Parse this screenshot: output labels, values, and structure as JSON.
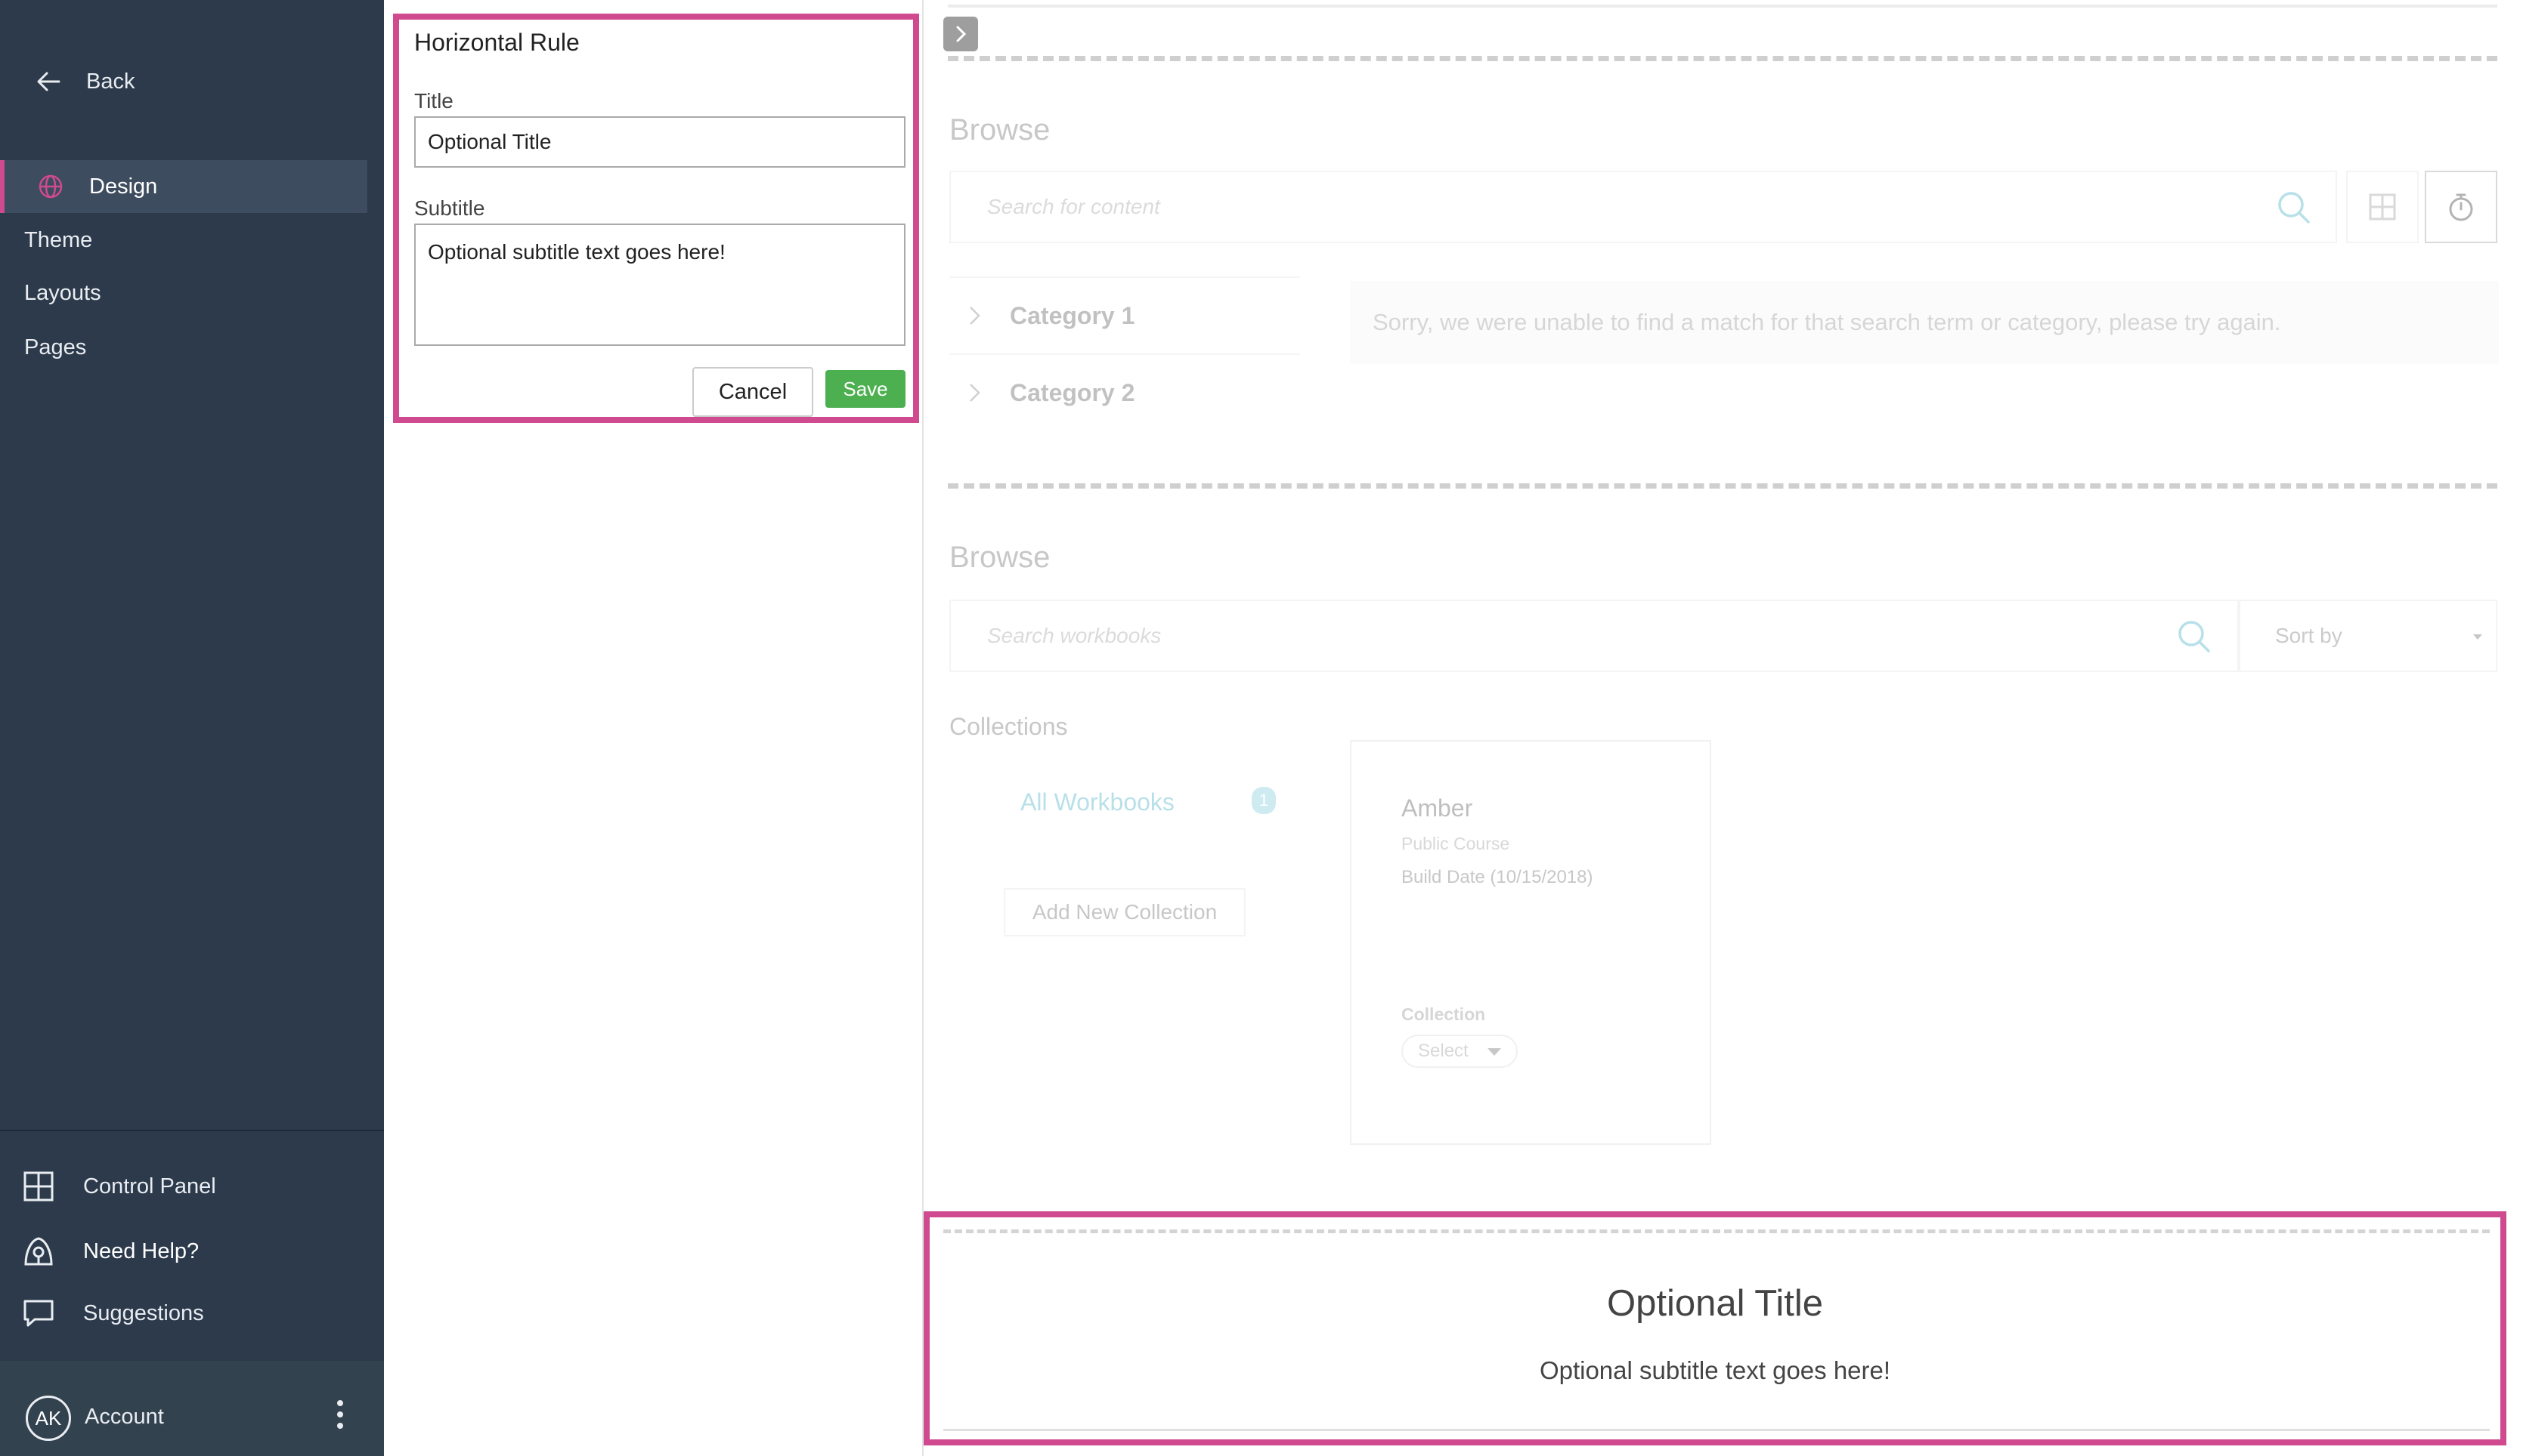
{
  "sidebar": {
    "back_label": "Back",
    "design_label": "Design",
    "items": [
      {
        "label": "Theme"
      },
      {
        "label": "Layouts"
      },
      {
        "label": "Pages"
      }
    ],
    "bottom": {
      "control_panel": "Control Panel",
      "need_help": "Need Help?",
      "suggestions": "Suggestions"
    },
    "account": {
      "initials": "AK",
      "label": "Account"
    }
  },
  "editor": {
    "heading": "Horizontal Rule",
    "title_label": "Title",
    "title_value": "Optional Title",
    "subtitle_label": "Subtitle",
    "subtitle_value": "Optional subtitle text goes here!",
    "cancel_label": "Cancel",
    "save_label": "Save"
  },
  "canvas": {
    "browse1": {
      "title": "Browse",
      "search_placeholder": "Search for content",
      "categories": [
        {
          "label": "Category 1"
        },
        {
          "label": "Category 2"
        }
      ],
      "no_match_text": "Sorry, we were unable to find a match for that search term or category, please try again."
    },
    "browse2": {
      "title": "Browse",
      "search_placeholder": "Search workbooks",
      "sort_label": "Sort by",
      "collections_label": "Collections",
      "all_workbooks": "All Workbooks",
      "all_workbooks_count": "1",
      "add_collection": "Add New Collection",
      "card": {
        "name": "Amber",
        "type": "Public Course",
        "build_date": "Build Date (10/15/2018)",
        "collection_label": "Collection",
        "select_label": "Select"
      }
    }
  },
  "preview": {
    "title": "Optional Title",
    "subtitle": "Optional subtitle text goes here!"
  },
  "colors": {
    "sidebar_bg": "#2c3a4b",
    "highlight": "#d04a8f",
    "save_green": "#4caf50",
    "accent_teal": "#7ec6d8"
  }
}
